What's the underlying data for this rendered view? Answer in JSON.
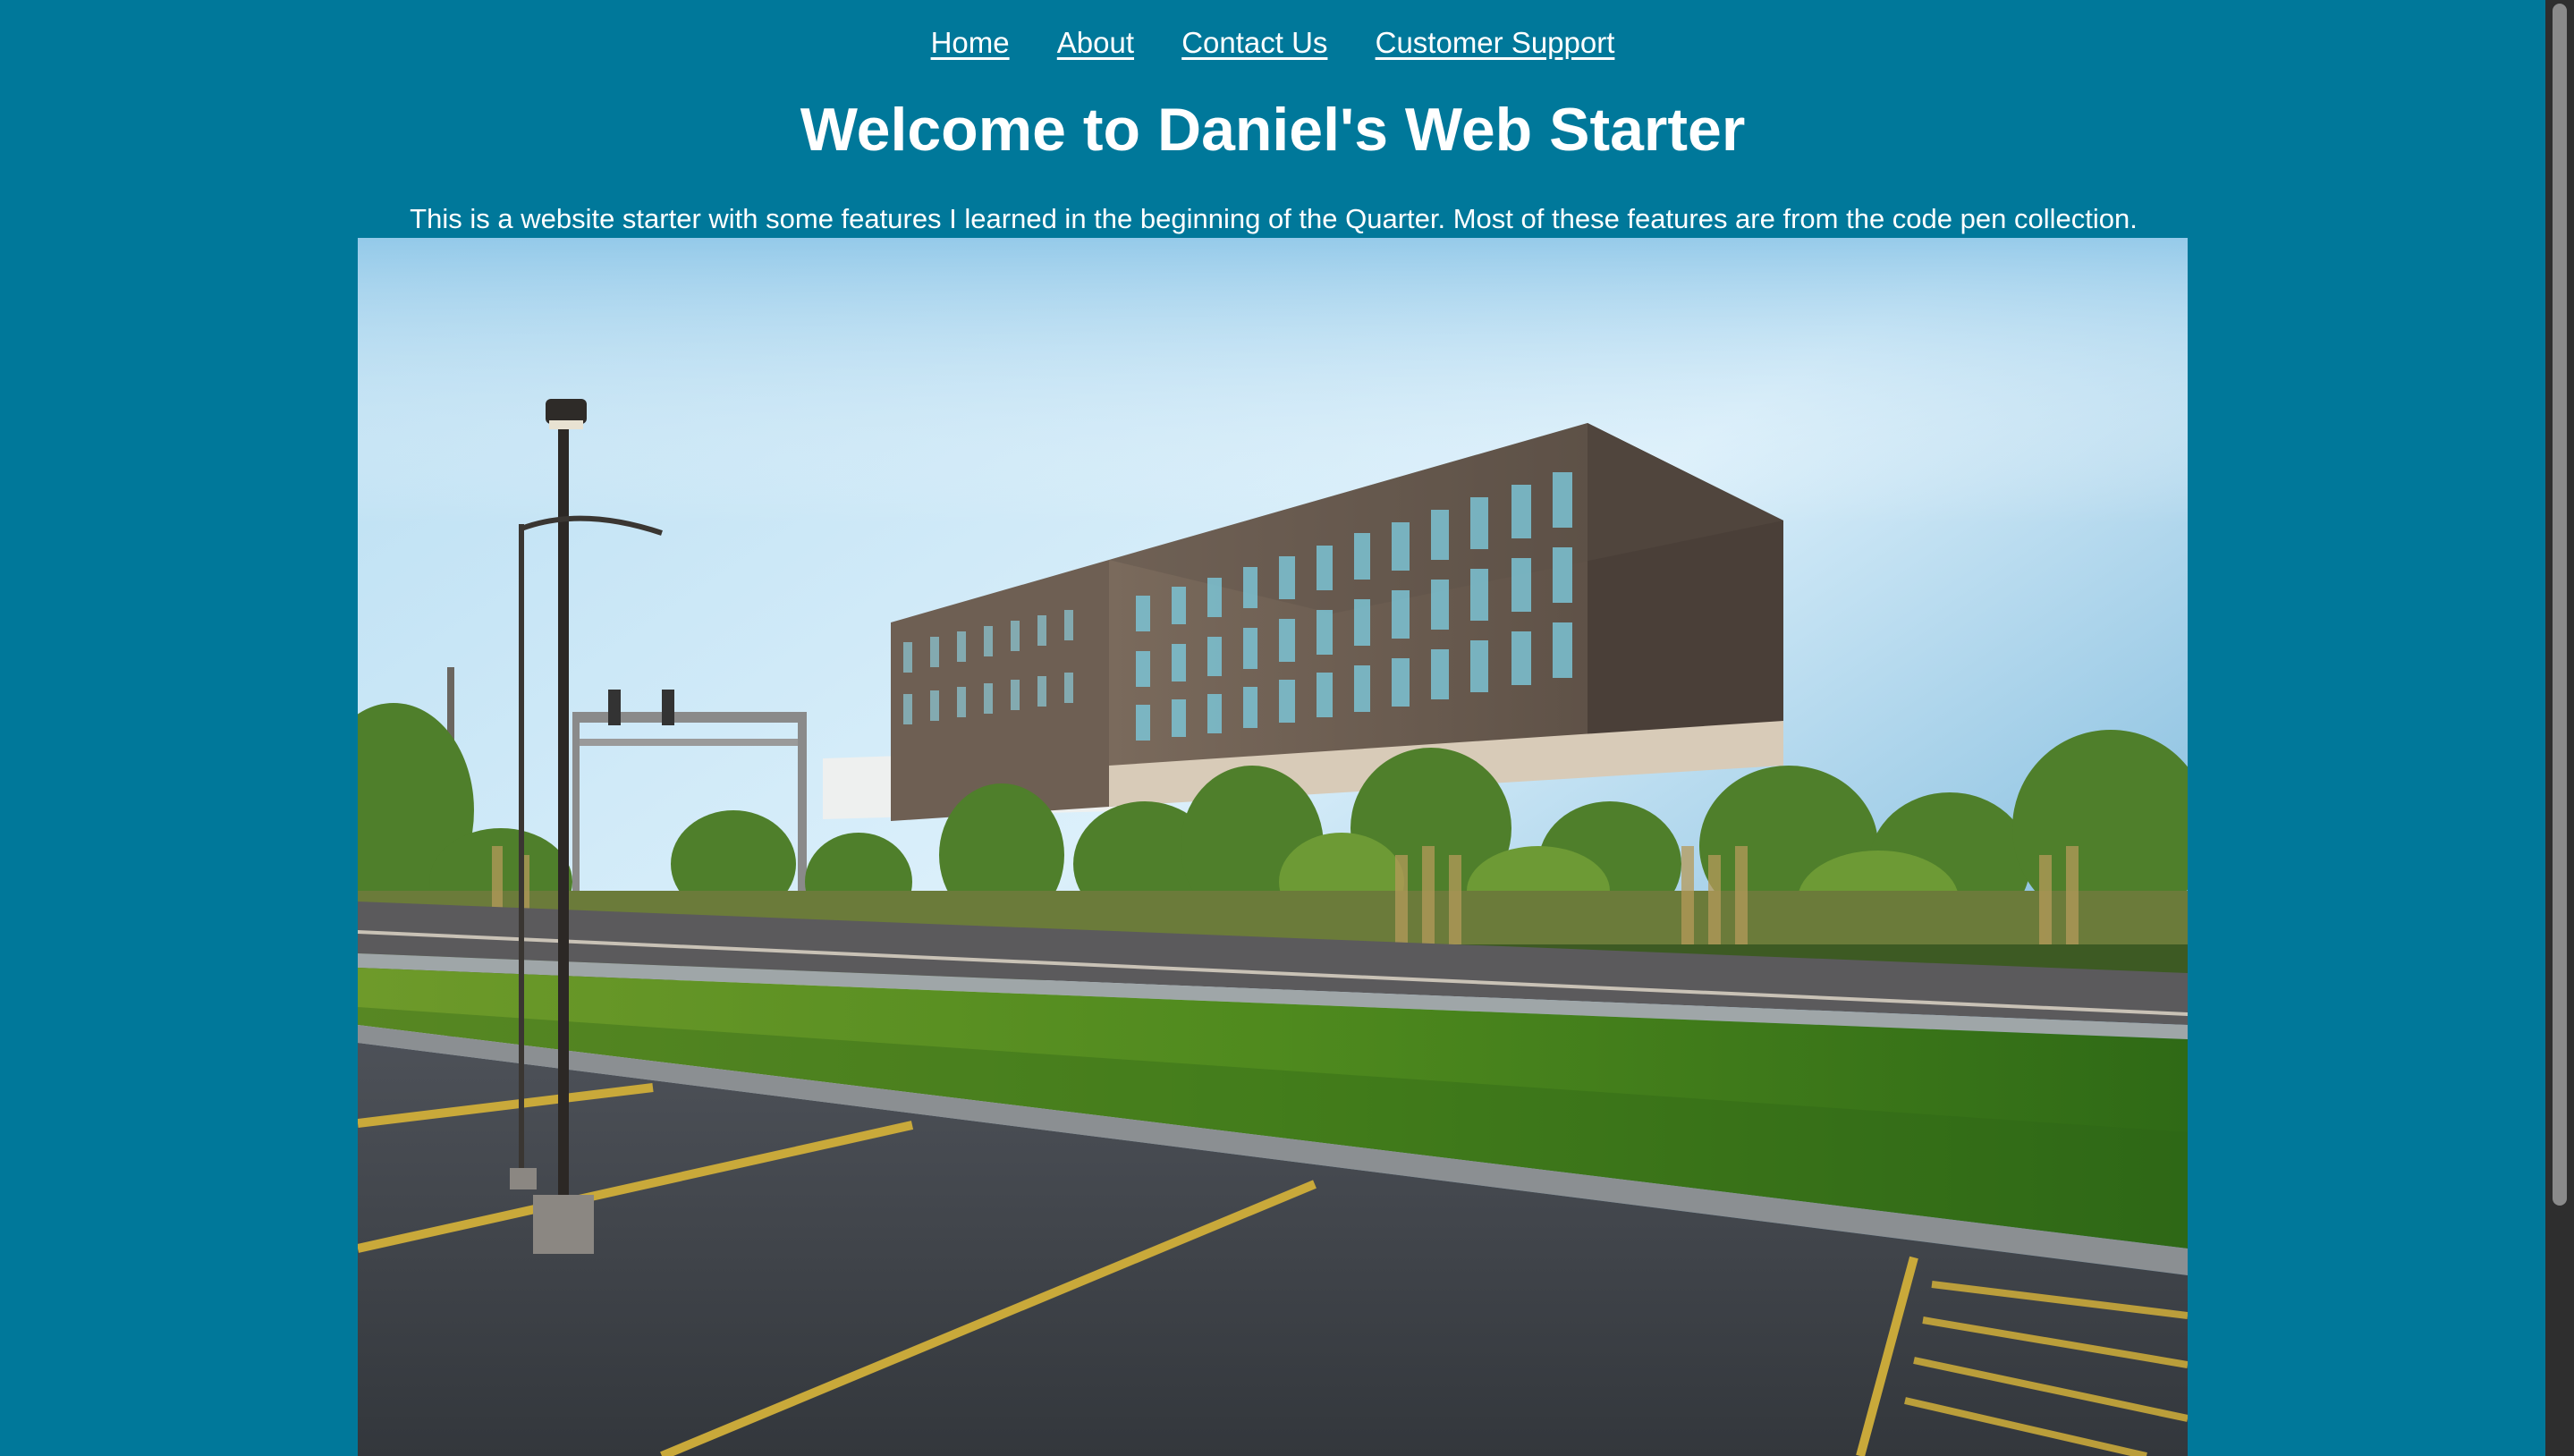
{
  "nav": {
    "items": [
      {
        "label": "Home"
      },
      {
        "label": "About"
      },
      {
        "label": "Contact Us"
      },
      {
        "label": "Customer Support"
      }
    ]
  },
  "header": {
    "title": "Welcome to Daniel's Web Starter"
  },
  "main": {
    "intro": "This is a website starter with some features I learned in the beginning of the Quarter. Most of these features are from the code pen collection."
  },
  "colors": {
    "background": "#00789a",
    "text": "#ffffff",
    "scrollbar": "#2e2e2e"
  }
}
